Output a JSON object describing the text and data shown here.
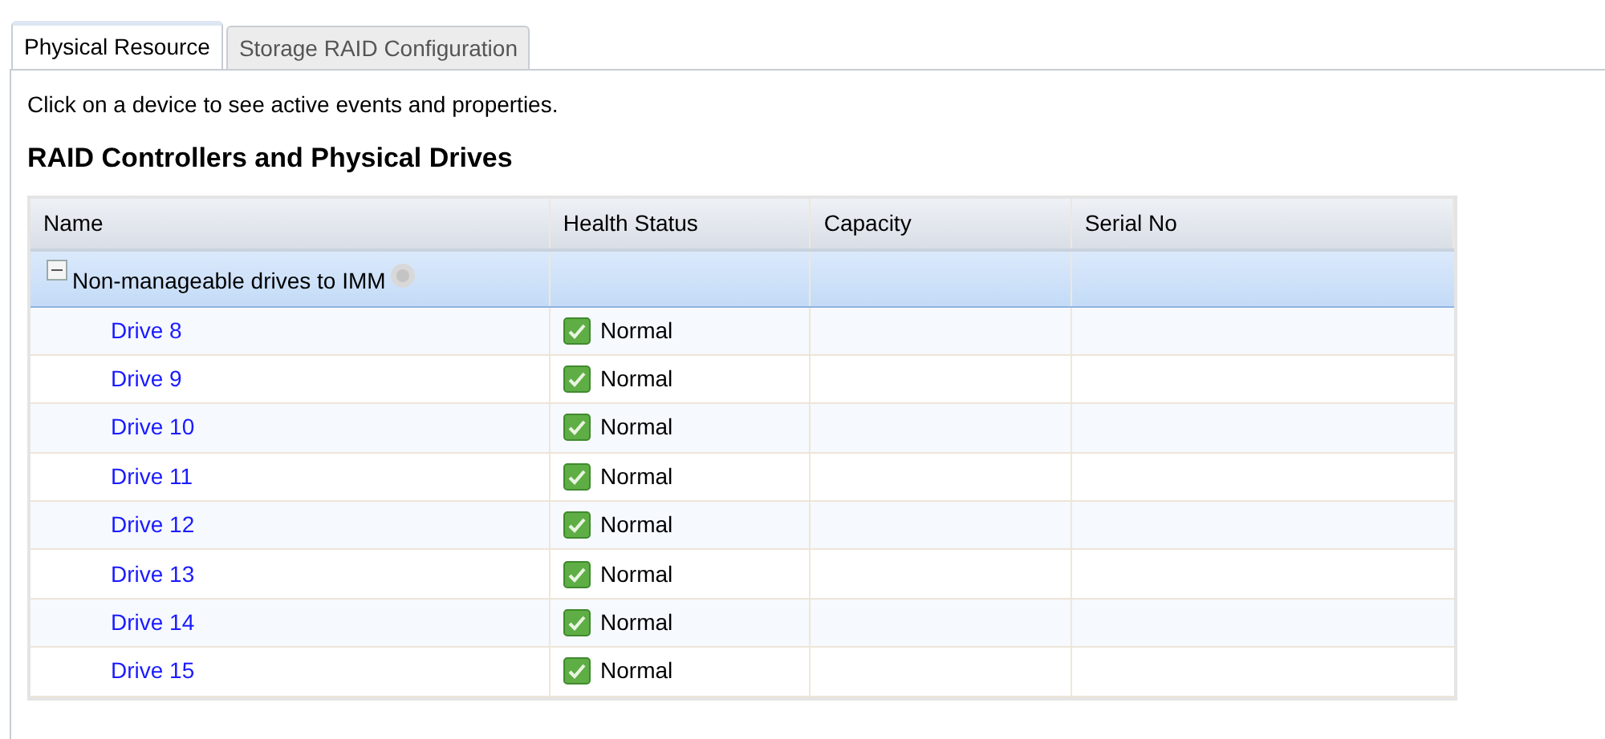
{
  "tabs": [
    {
      "label": "Physical Resource",
      "selected": true
    },
    {
      "label": "Storage RAID Configuration",
      "selected": false
    }
  ],
  "instructions": "Click on a device to see active events and properties.",
  "heading": "RAID Controllers and Physical Drives",
  "table": {
    "columns": [
      "Name",
      "Health Status",
      "Capacity",
      "Serial No"
    ],
    "groups": [
      {
        "name": "Non-manageable drives to IMM",
        "expanded": true,
        "rows": [
          {
            "name": "Drive 8",
            "health": "Normal",
            "kind": "normal"
          },
          {
            "name": "Drive 9",
            "health": "Normal",
            "kind": "normal"
          },
          {
            "name": "Drive 10",
            "health": "Normal",
            "kind": "normal"
          },
          {
            "name": "Drive 11",
            "health": "Normal",
            "kind": "normal"
          },
          {
            "name": "Drive 12",
            "health": "Normal",
            "kind": "normal"
          },
          {
            "name": "Drive 13",
            "health": "Normal",
            "kind": "normal"
          },
          {
            "name": "Drive 14",
            "health": "Normal",
            "kind": "normal"
          },
          {
            "name": "Drive 15",
            "health": "Normal",
            "kind": "normal"
          }
        ]
      }
    ]
  }
}
